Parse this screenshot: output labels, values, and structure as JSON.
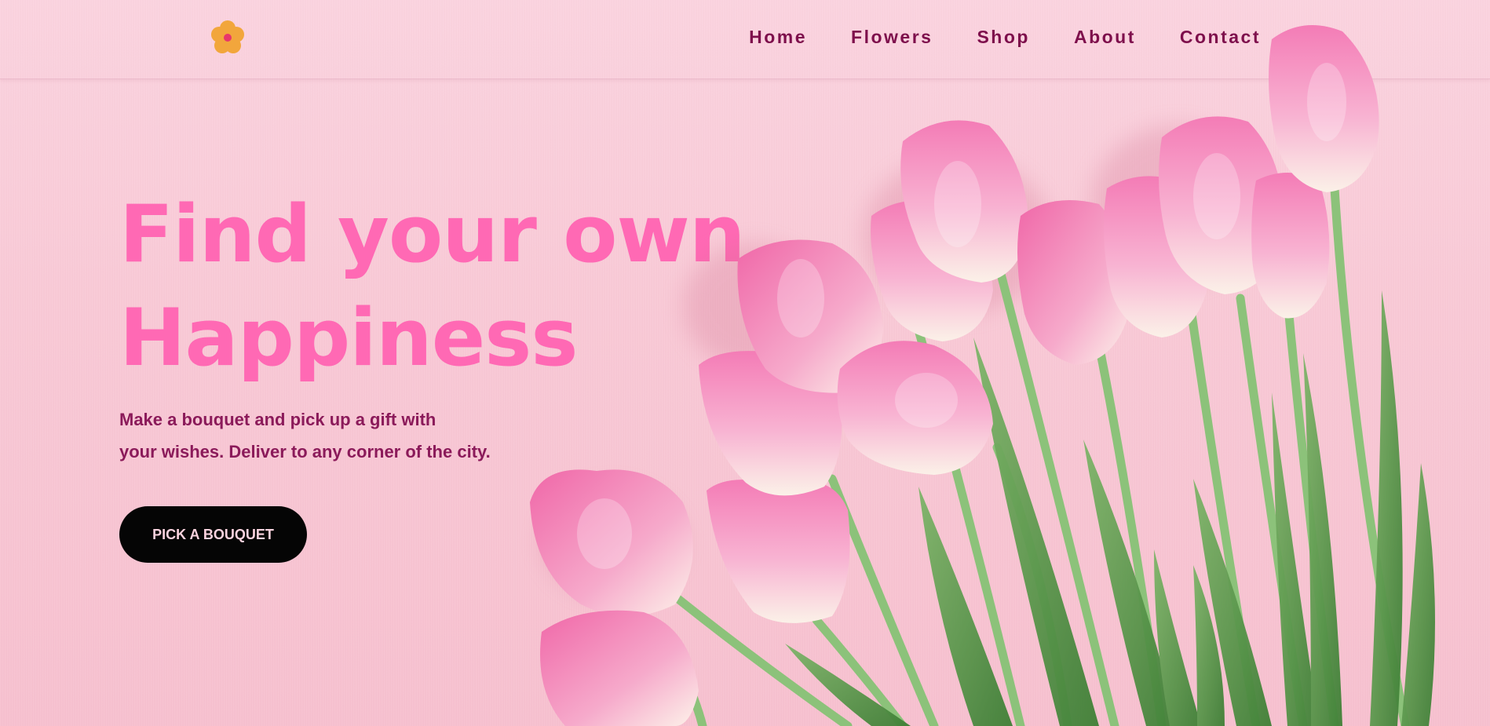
{
  "nav": {
    "items": [
      "Home",
      "Flowers",
      "Shop",
      "About",
      "Contact"
    ]
  },
  "hero": {
    "title_line1": "Find your own",
    "title_line2": "Happiness",
    "subtitle_line1": "Make a bouquet and pick up a gift with",
    "subtitle_line2": "your wishes. Deliver to any corner of the city.",
    "cta_label": "PICK A BOUQUET"
  },
  "colors": {
    "background": "#fbd3df",
    "title": "#ff69b4",
    "nav_text": "#7e0f4c",
    "subtitle": "#8b1a5a",
    "button_bg": "#050505",
    "button_text": "#fbd3df",
    "logo_petals": "#f2a63c",
    "logo_center": "#e8366b"
  },
  "icons": {
    "logo": "flower-logo-icon",
    "hero_image": "pink-tulips-image"
  }
}
